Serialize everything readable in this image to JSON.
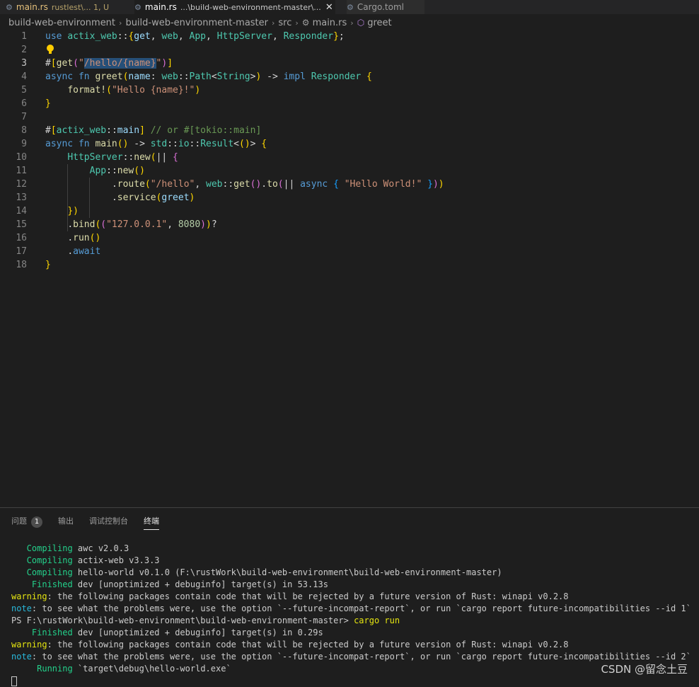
{
  "tabs": [
    {
      "icon": "rust-icon",
      "name": "main.rs",
      "detail": "rustlest\\... 1, U",
      "modified": true
    },
    {
      "icon": "rust-icon",
      "name": "main.rs",
      "detail": "...\\build-web-environment-master\\...",
      "close": "✕"
    },
    {
      "icon": "gear-icon",
      "name": "Cargo.toml"
    }
  ],
  "breadcrumb": {
    "items": [
      "build-web-environment",
      "build-web-environment-master",
      "src",
      "main.rs",
      "greet"
    ],
    "separator": "›"
  },
  "editor": {
    "line_numbers": [
      "1",
      "2",
      "3",
      "4",
      "5",
      "6",
      "7",
      "8",
      "9",
      "10",
      "11",
      "12",
      "13",
      "14",
      "15",
      "16",
      "17",
      "18"
    ],
    "current_line": "3",
    "selection": "/hello/{name}",
    "lines": [
      "use actix_web::{get, web, App, HttpServer, Responder};",
      "",
      "#[get(\"/hello/{name}\")]",
      "async fn greet(name: web::Path<String>) -> impl Responder {",
      "    format!(\"Hello {name}!\")",
      "}",
      "",
      "#[actix_web::main] // or #[tokio::main]",
      "async fn main() -> std::io::Result<()> {",
      "    HttpServer::new(|| {",
      "        App::new()",
      "            .route(\"/hello\", web::get().to(|| async { \"Hello World!\" }))",
      "            .service(greet)",
      "    })",
      "    .bind((\"127.0.0.1\", 8080))?",
      "    .run()",
      "    .await",
      "}"
    ]
  },
  "panel": {
    "tabs": [
      {
        "label": "问题",
        "badge": "1"
      },
      {
        "label": "输出"
      },
      {
        "label": "调试控制台"
      },
      {
        "label": "终端",
        "active": true
      }
    ]
  },
  "terminal": {
    "lines": [
      {
        "prefix": "   Compiling",
        "prefix_color": "green",
        "text": " awc v2.0.3"
      },
      {
        "prefix": "   Compiling",
        "prefix_color": "green",
        "text": " actix-web v3.3.3"
      },
      {
        "prefix": "   Compiling",
        "prefix_color": "green",
        "text": " hello-world v0.1.0 (F:\\rustWork\\build-web-environment\\build-web-environment-master)"
      },
      {
        "prefix": "    Finished",
        "prefix_color": "green",
        "text": " dev [unoptimized + debuginfo] target(s) in 53.13s"
      },
      {
        "prefix": "warning",
        "prefix_color": "yellow",
        "text": ": the following packages contain code that will be rejected by a future version of Rust: winapi v0.2.8"
      },
      {
        "prefix": "note",
        "prefix_color": "cyan",
        "text": ": to see what the problems were, use the option `--future-incompat-report`, or run `cargo report future-incompatibilities --id 1`"
      },
      {
        "prefix": "PS F:\\rustWork\\build-web-environment\\build-web-environment-master> ",
        "prefix_color": "plain",
        "text": "cargo run",
        "text_color": "yellow"
      },
      {
        "prefix": "    Finished",
        "prefix_color": "green",
        "text": " dev [unoptimized + debuginfo] target(s) in 0.29s"
      },
      {
        "prefix": "warning",
        "prefix_color": "yellow",
        "text": ": the following packages contain code that will be rejected by a future version of Rust: winapi v0.2.8"
      },
      {
        "prefix": "note",
        "prefix_color": "cyan",
        "text": ": to see what the problems were, use the option `--future-incompat-report`, or run `cargo report future-incompatibilities --id 2`"
      },
      {
        "prefix": "     Running",
        "prefix_color": "green",
        "text": " `target\\debug\\hello-world.exe`"
      }
    ]
  },
  "watermark": "CSDN @留念土豆",
  "colors": {
    "background": "#1e1e1e",
    "keyword": "#569cd6",
    "function": "#dcdcaa",
    "type": "#4ec9b0",
    "string": "#ce9178",
    "number": "#b5cea8",
    "comment": "#6a9955",
    "terminal_green": "#23d18b",
    "terminal_yellow": "#e5e510",
    "terminal_cyan": "#29b8db"
  }
}
